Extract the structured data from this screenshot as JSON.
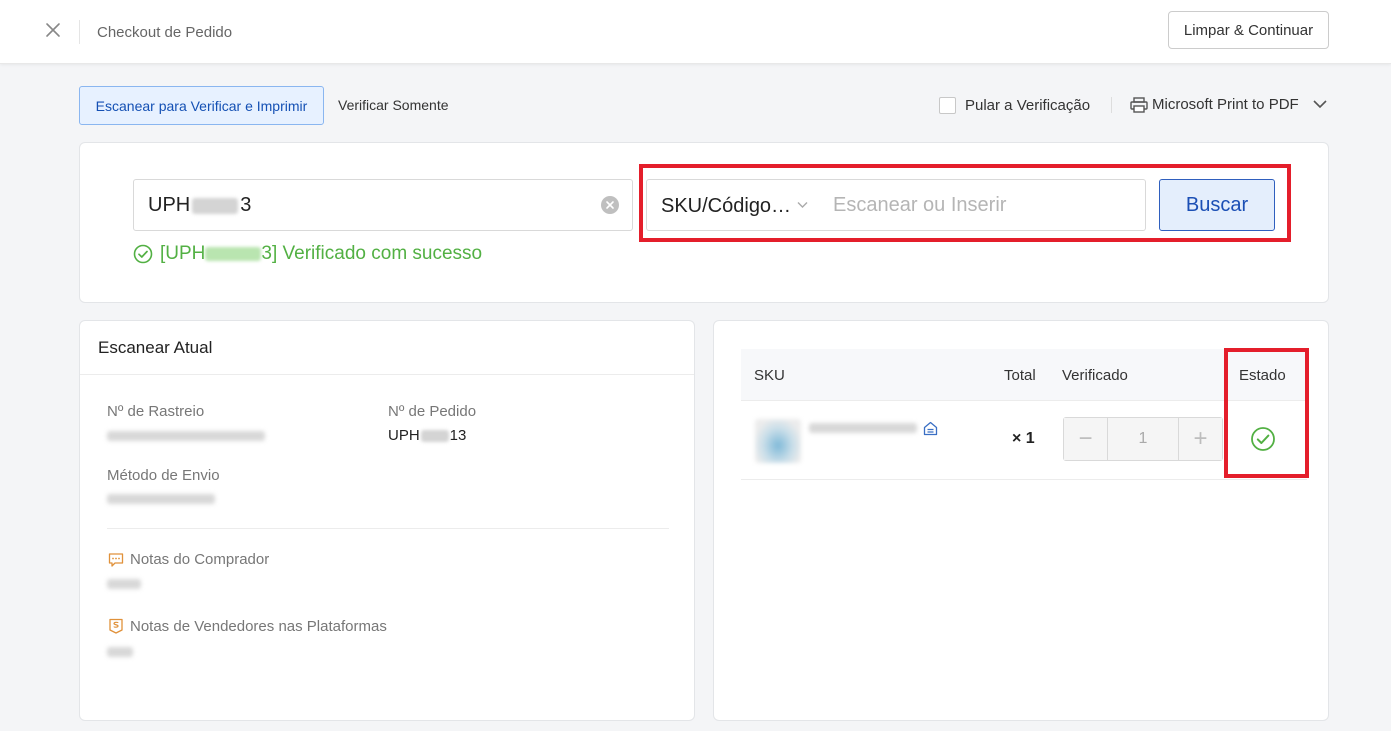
{
  "header": {
    "title": "Checkout de Pedido",
    "clear_button": "Limpar & Continuar"
  },
  "modes": {
    "active": "Escanear para Verificar e Imprimir",
    "other": "Verificar Somente"
  },
  "options": {
    "skip_label": "Pular a Verificação",
    "printer": "Microsoft Print to PDF"
  },
  "scan": {
    "order_prefix": "UPH",
    "order_suffix": "3",
    "success_prefix": "[UPH",
    "success_suffix": "3] Verificado com sucesso",
    "select_value": "SKU/Código…",
    "input_placeholder": "Escanear ou Inserir",
    "search_button": "Buscar"
  },
  "current": {
    "title": "Escanear Atual",
    "tracking_label": "Nº de Rastreio",
    "order_label": "Nº de Pedido",
    "order_prefix": "UPH",
    "order_suffix": "13",
    "shipping_label": "Método de Envio",
    "buyer_notes_label": "Notas do Comprador",
    "seller_notes_label": "Notas de Vendedores nas Plataformas"
  },
  "table": {
    "columns": [
      "SKU",
      "Total",
      "Verificado",
      "Estado"
    ],
    "rows": [
      {
        "total": "× 1",
        "verified": "1"
      }
    ]
  },
  "colors": {
    "accent": "#1b4fb5",
    "success": "#52b043",
    "highlight": "#e41e2b",
    "note_icon": "#e0913a"
  },
  "icons": {
    "close": "close-icon",
    "printer": "printer-icon",
    "status": "check-circle-icon"
  }
}
